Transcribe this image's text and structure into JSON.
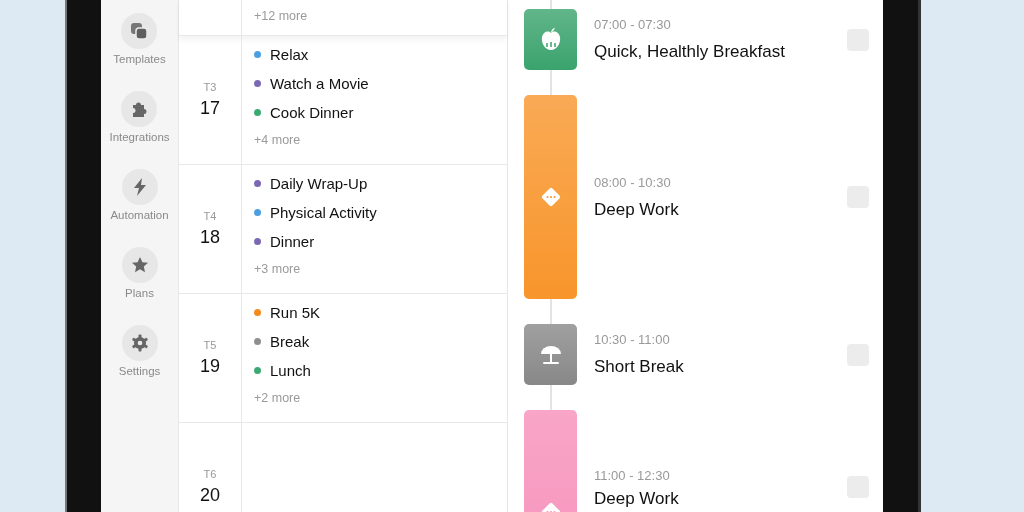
{
  "sidebar": {
    "items": [
      {
        "label": "Templates",
        "kind": "templates"
      },
      {
        "label": "Integrations",
        "kind": "integrations"
      },
      {
        "label": "Automation",
        "kind": "automation"
      },
      {
        "label": "Plans",
        "kind": "plans"
      },
      {
        "label": "Settings",
        "kind": "settings"
      }
    ]
  },
  "days": [
    {
      "more": "+12 more"
    },
    {
      "weekday": "T3",
      "day": "17",
      "more": "+4 more",
      "events": [
        {
          "title": "Relax",
          "color": "#4a9fe0"
        },
        {
          "title": "Watch a Movie",
          "color": "#7b68b5"
        },
        {
          "title": "Cook Dinner",
          "color": "#3aaa72"
        }
      ]
    },
    {
      "weekday": "T4",
      "day": "18",
      "more": "+3 more",
      "events": [
        {
          "title": "Daily Wrap-Up",
          "color": "#7b68b5"
        },
        {
          "title": "Physical Activity",
          "color": "#4a9fe0"
        },
        {
          "title": "Dinner",
          "color": "#7b68b5"
        }
      ]
    },
    {
      "weekday": "T5",
      "day": "19",
      "more": "+2 more",
      "events": [
        {
          "title": "Run 5K",
          "color": "#f48a1e"
        },
        {
          "title": "Break",
          "color": "#8e8e8e"
        },
        {
          "title": "Lunch",
          "color": "#3aaa72"
        }
      ]
    },
    {
      "weekday": "T6",
      "day": "20"
    }
  ],
  "timeline": [
    {
      "time": "07:00 - 07:30",
      "title": "Quick, Healthly Breakfast",
      "kind": "breakfast",
      "color": "#3aa36d",
      "long": false,
      "checked": false
    },
    {
      "time": "08:00 - 10:30",
      "title": "Deep Work",
      "kind": "focus",
      "color": "#f8952b",
      "long": true,
      "checked": false
    },
    {
      "time": "10:30 - 11:00",
      "title": "Short Break",
      "kind": "break",
      "color": "#888888",
      "long": false,
      "checked": false
    },
    {
      "time": "11:00 - 12:30",
      "title": "Deep Work",
      "kind": "focus",
      "color": "#f78fba",
      "long": true,
      "checked": false
    }
  ]
}
